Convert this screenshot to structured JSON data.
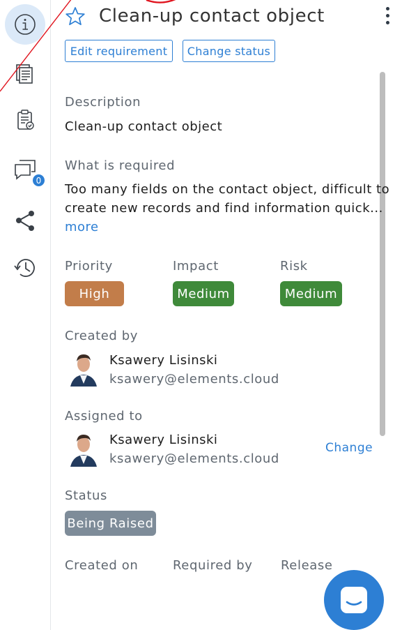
{
  "header": {
    "title": "Clean-up contact object",
    "edit_requirement": "Edit requirement",
    "change_status": "Change status"
  },
  "rail": {
    "items": [
      {
        "icon": "info-icon"
      },
      {
        "icon": "documents-icon"
      },
      {
        "icon": "clipboard-check-icon"
      },
      {
        "icon": "comments-icon",
        "badge": "0"
      },
      {
        "icon": "share-icon"
      },
      {
        "icon": "history-icon"
      }
    ]
  },
  "description": {
    "label": "Description",
    "value": "Clean-up contact object"
  },
  "what_required": {
    "label": "What is required",
    "line1": "Too many fields on the contact object, difficult to",
    "line2": "create new records and find information quick...",
    "more": "more"
  },
  "ratings": {
    "priority": {
      "label": "Priority",
      "value": "High",
      "color": "#c27d4a"
    },
    "impact": {
      "label": "Impact",
      "value": "Medium",
      "color": "#3f8a3a"
    },
    "risk": {
      "label": "Risk",
      "value": "Medium",
      "color": "#3f8a3a"
    }
  },
  "created_by": {
    "label": "Created by",
    "name": "Ksawery Lisinski",
    "email": "ksawery@elements.cloud"
  },
  "assigned_to": {
    "label": "Assigned to",
    "name": "Ksawery Lisinski",
    "email": "ksawery@elements.cloud",
    "change": "Change"
  },
  "status": {
    "label": "Status",
    "value": "Being Raised",
    "color": "#7e8c99"
  },
  "footer_labels": {
    "created_on": "Created on",
    "required_by": "Required by",
    "release": "Release"
  },
  "colors": {
    "accent": "#2d7fd4",
    "annotation": "#e0141e"
  }
}
